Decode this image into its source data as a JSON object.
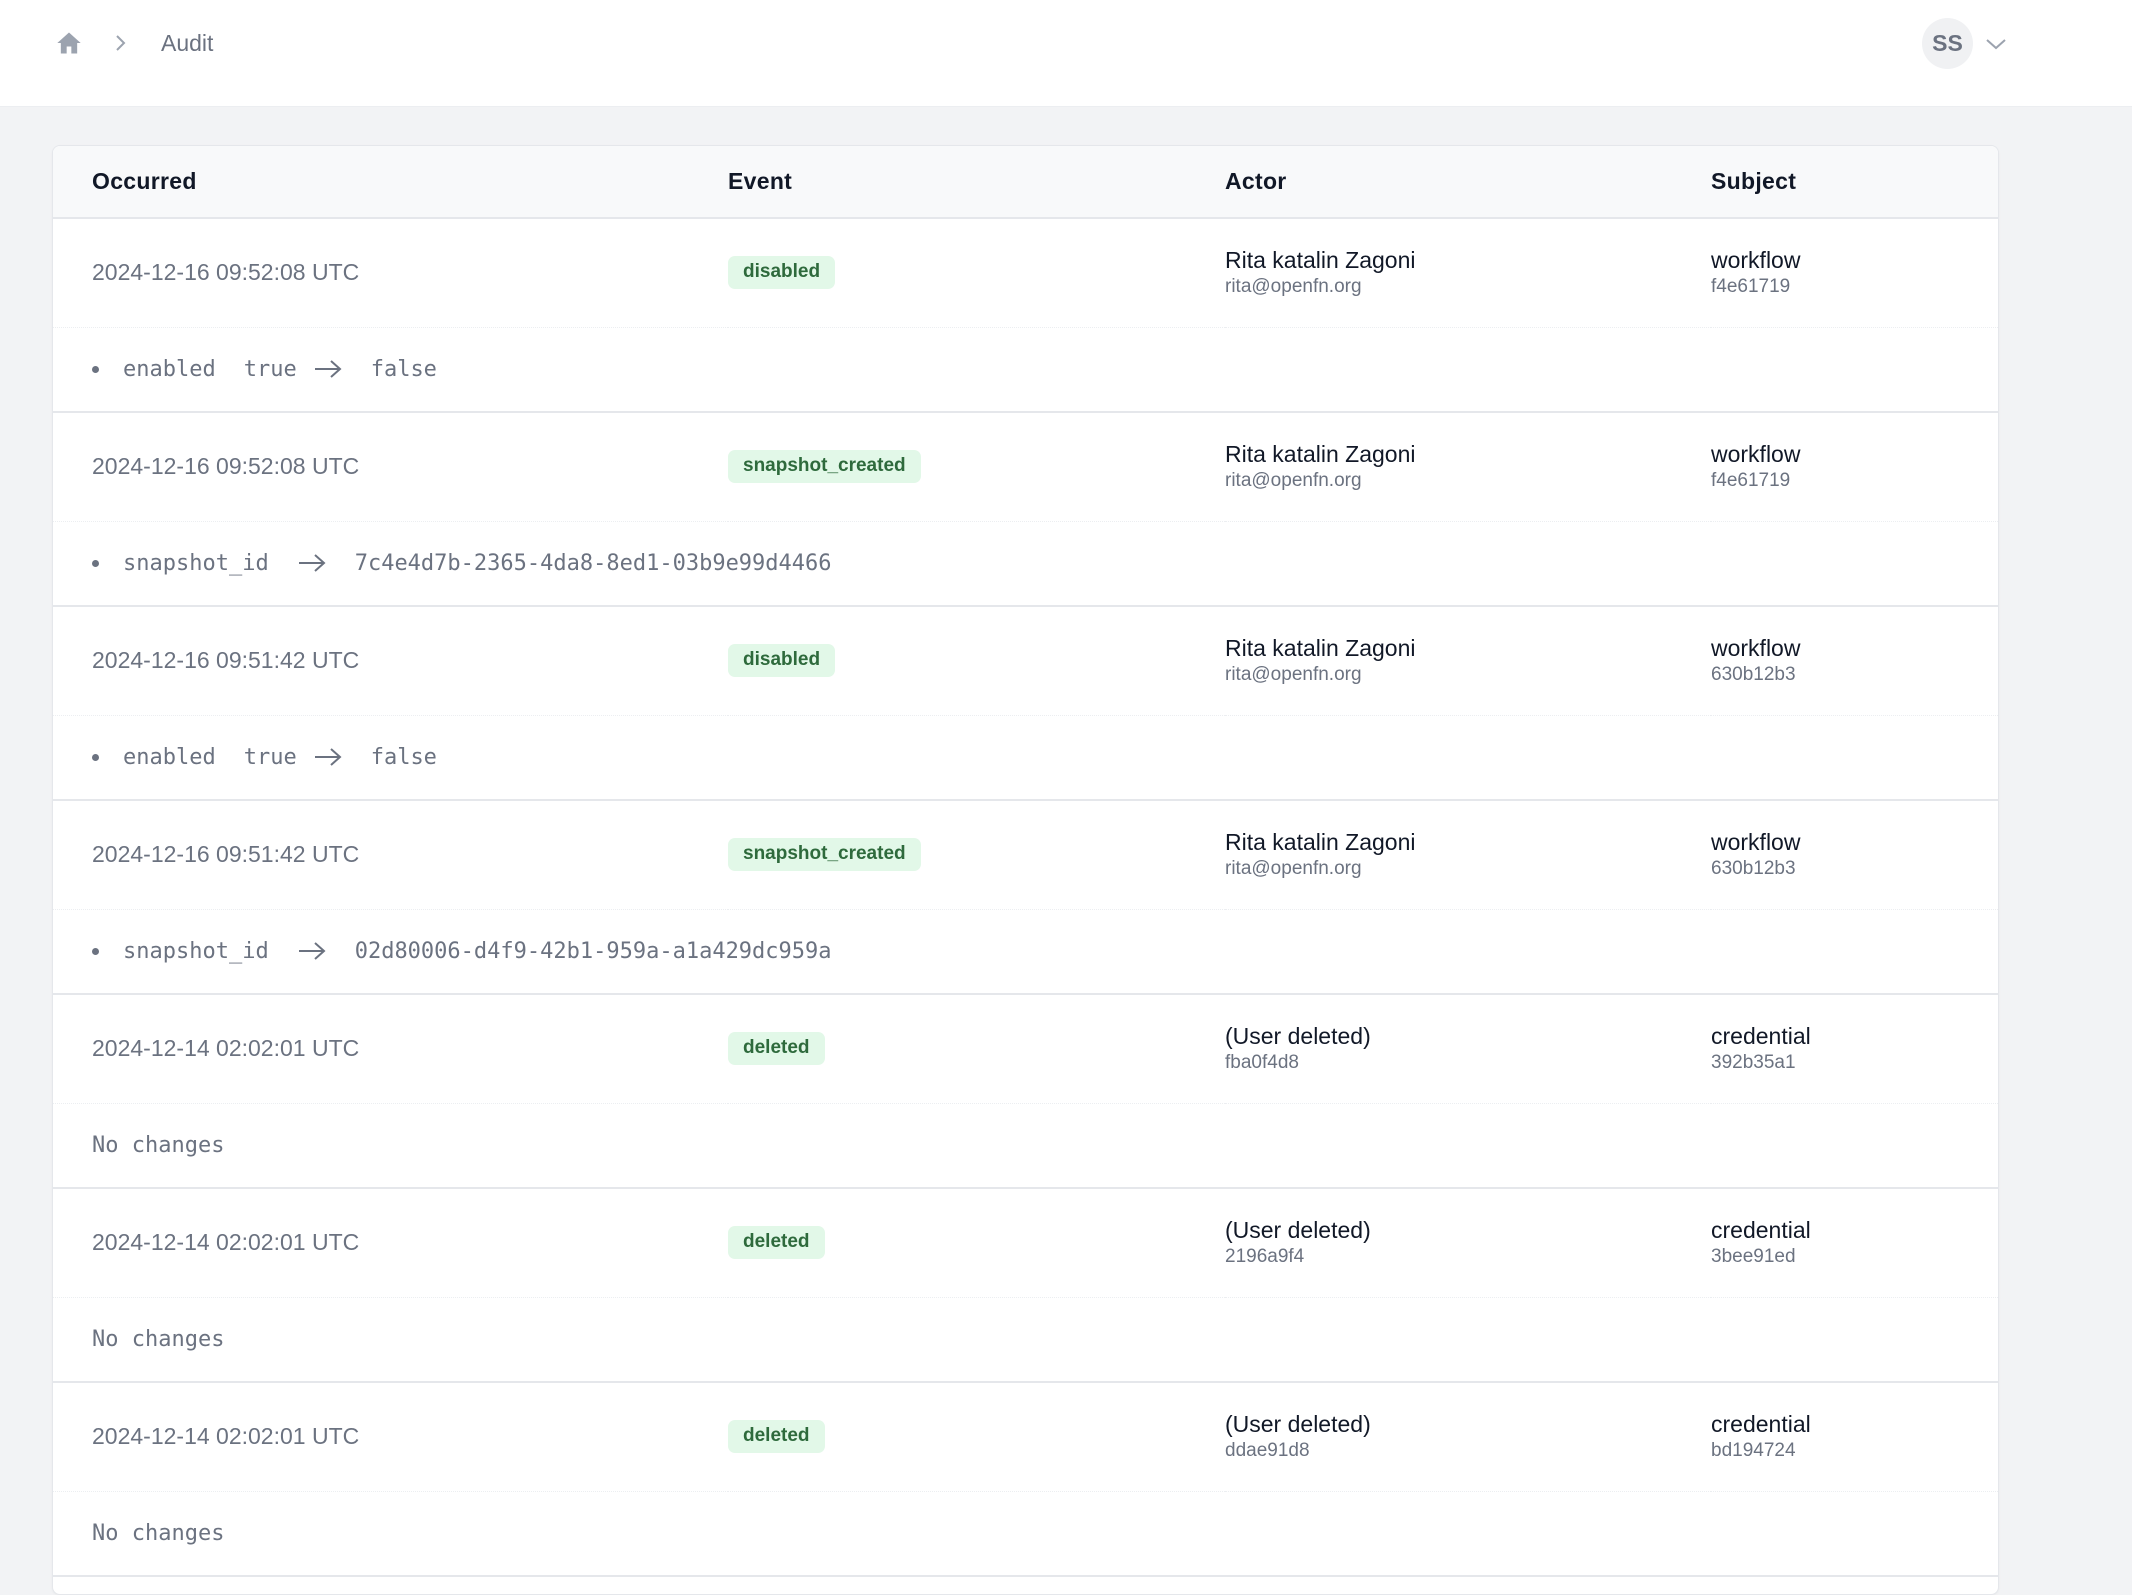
{
  "header": {
    "home_icon": "home-icon",
    "breadcrumb_separator_icon": "chevron-right-icon",
    "breadcrumb_current": "Audit",
    "user_initials": "SS",
    "user_menu_icon": "chevron-down-icon"
  },
  "table": {
    "columns": [
      "Occurred",
      "Event",
      "Actor",
      "Subject"
    ],
    "rows": [
      {
        "occurred": "2024-12-16 09:52:08 UTC",
        "event": "disabled",
        "actor_name": "Rita katalin Zagoni",
        "actor_detail": "rita@openfn.org",
        "subject_type": "workflow",
        "subject_id": "f4e61719",
        "change": {
          "key": "enabled",
          "before": "true",
          "after": "false"
        }
      },
      {
        "occurred": "2024-12-16 09:52:08 UTC",
        "event": "snapshot_created",
        "actor_name": "Rita katalin Zagoni",
        "actor_detail": "rita@openfn.org",
        "subject_type": "workflow",
        "subject_id": "f4e61719",
        "change": {
          "key": "snapshot_id",
          "before": "",
          "after": "7c4e4d7b-2365-4da8-8ed1-03b9e99d4466"
        }
      },
      {
        "occurred": "2024-12-16 09:51:42 UTC",
        "event": "disabled",
        "actor_name": "Rita katalin Zagoni",
        "actor_detail": "rita@openfn.org",
        "subject_type": "workflow",
        "subject_id": "630b12b3",
        "change": {
          "key": "enabled",
          "before": "true",
          "after": "false"
        }
      },
      {
        "occurred": "2024-12-16 09:51:42 UTC",
        "event": "snapshot_created",
        "actor_name": "Rita katalin Zagoni",
        "actor_detail": "rita@openfn.org",
        "subject_type": "workflow",
        "subject_id": "630b12b3",
        "change": {
          "key": "snapshot_id",
          "before": "",
          "after": "02d80006-d4f9-42b1-959a-a1a429dc959a"
        }
      },
      {
        "occurred": "2024-12-14 02:02:01 UTC",
        "event": "deleted",
        "actor_name": "(User deleted)",
        "actor_detail": "fba0f4d8",
        "subject_type": "credential",
        "subject_id": "392b35a1",
        "no_changes": "No changes"
      },
      {
        "occurred": "2024-12-14 02:02:01 UTC",
        "event": "deleted",
        "actor_name": "(User deleted)",
        "actor_detail": "2196a9f4",
        "subject_type": "credential",
        "subject_id": "3bee91ed",
        "no_changes": "No changes"
      },
      {
        "occurred": "2024-12-14 02:02:01 UTC",
        "event": "deleted",
        "actor_name": "(User deleted)",
        "actor_detail": "ddae91d8",
        "subject_type": "credential",
        "subject_id": "bd194724",
        "no_changes": "No changes"
      }
    ]
  },
  "colors": {
    "badge_bg": "#e2f8e8",
    "badge_text": "#2e6a3c",
    "page_bg": "#f2f3f5"
  }
}
